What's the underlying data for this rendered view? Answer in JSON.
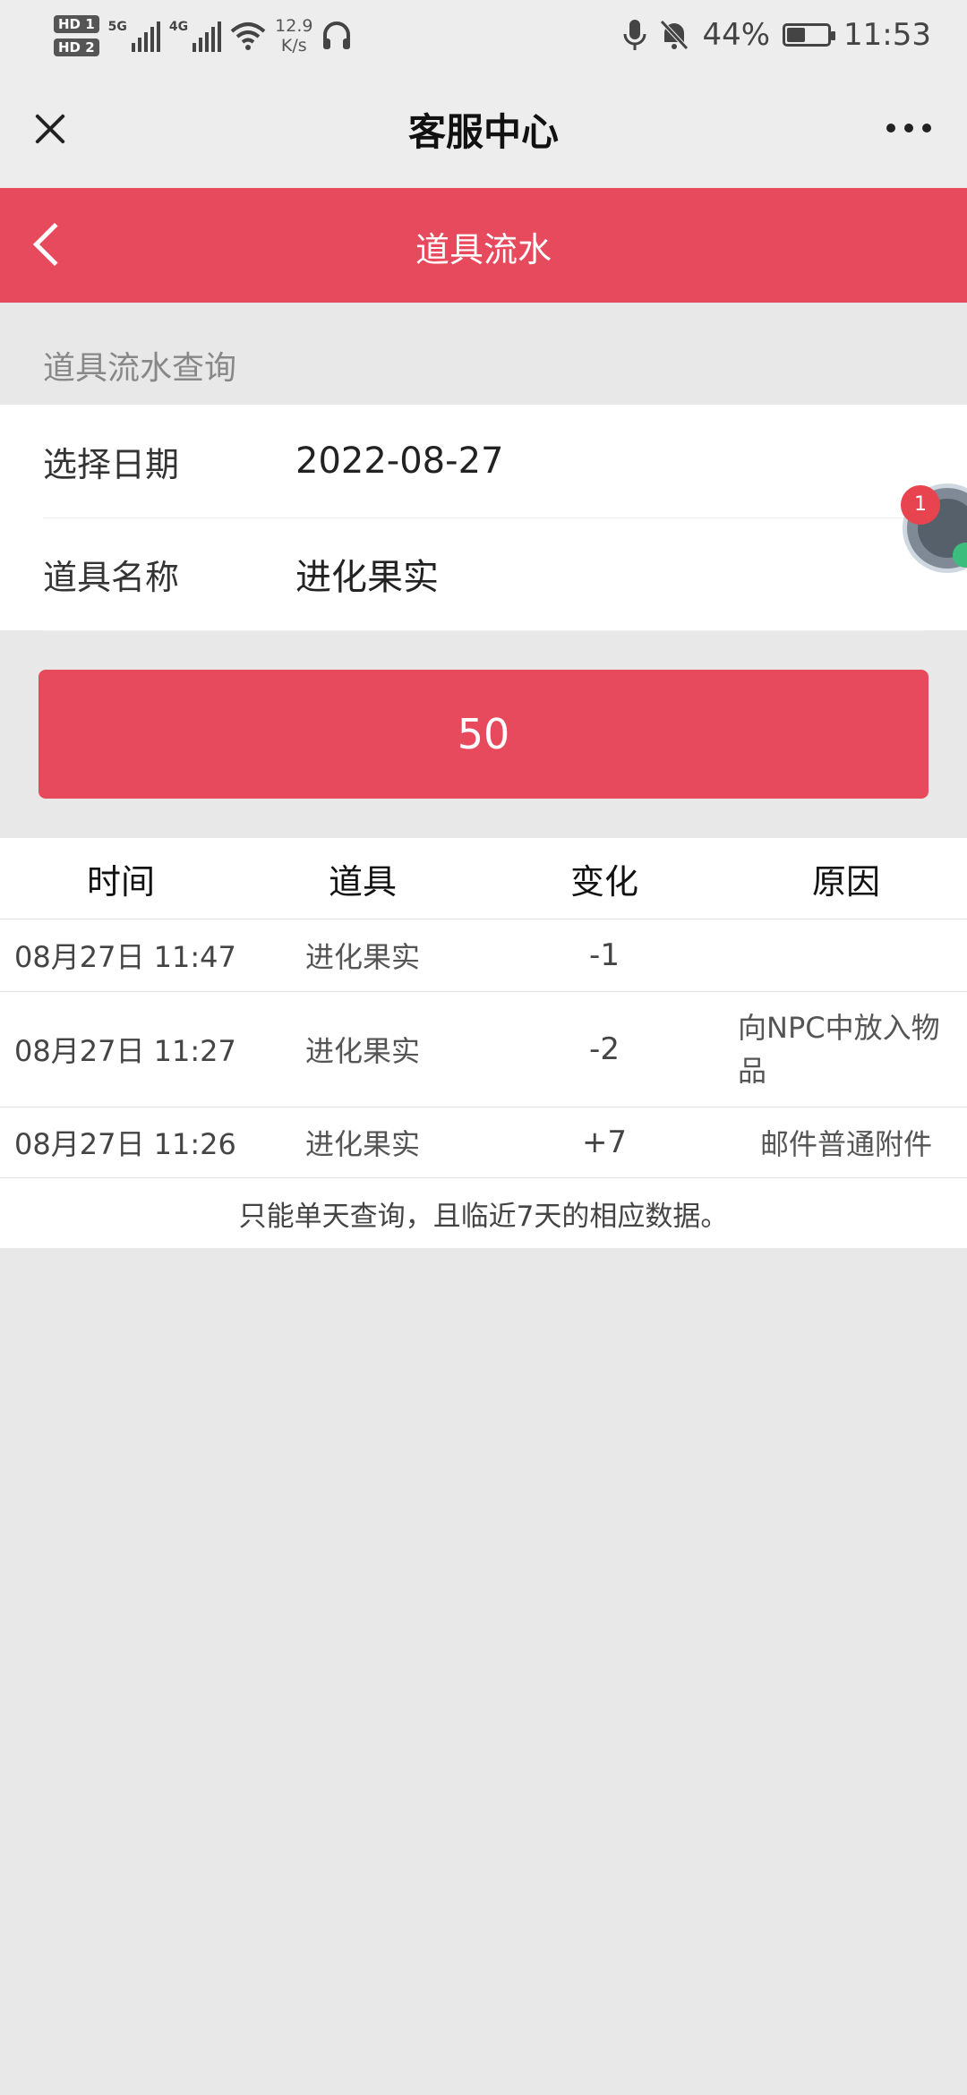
{
  "status_bar": {
    "hd1": "HD 1",
    "hd2": "HD 2",
    "net1": "5G",
    "net2": "4G",
    "speed_value": "12.9",
    "speed_unit": "K/s",
    "battery": "44%",
    "time": "11:53",
    "icons": [
      "headphones-icon",
      "mic-icon",
      "bell-off-icon",
      "battery-icon",
      "wifi-icon"
    ]
  },
  "titlebar": {
    "title": "客服中心"
  },
  "header": {
    "title": "道具流水"
  },
  "section": {
    "title": "道具流水查询"
  },
  "form": {
    "date_label": "选择日期",
    "date_value": "2022-08-27",
    "item_label": "道具名称",
    "item_value": "进化果实"
  },
  "float_ball": {
    "badge": "1"
  },
  "query_button": {
    "label": "50"
  },
  "table": {
    "headers": [
      "时间",
      "道具",
      "变化",
      "原因"
    ],
    "rows": [
      {
        "time": "08月27日 11:47",
        "item": "进化果实",
        "change": "-1",
        "reason": ""
      },
      {
        "time": "08月27日 11:27",
        "item": "进化果实",
        "change": "-2",
        "reason": "向NPC中放入物品"
      },
      {
        "time": "08月27日 11:26",
        "item": "进化果实",
        "change": "+7",
        "reason": "邮件普通附件"
      }
    ],
    "footnote": "只能单天查询，且临近7天的相应数据。"
  },
  "colors": {
    "accent": "#e84a5d",
    "background": "#e8e8e8"
  }
}
